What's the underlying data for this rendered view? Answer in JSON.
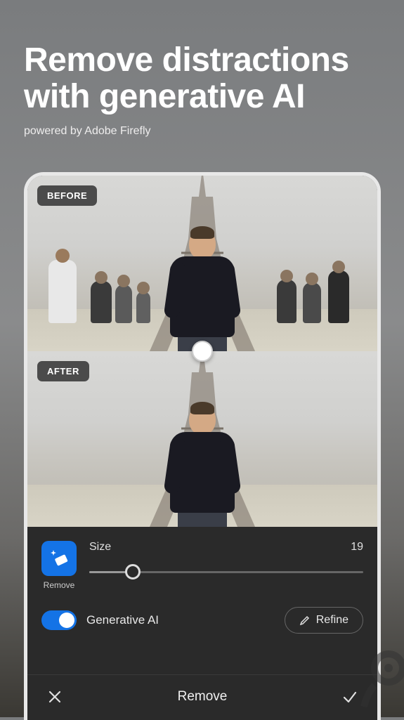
{
  "hero": {
    "title": "Remove distractions with generative AI",
    "subtitle": "powered by Adobe Firefly"
  },
  "comparison": {
    "before_label": "BEFORE",
    "after_label": "AFTER"
  },
  "editor": {
    "tool_label": "Remove",
    "size_label": "Size",
    "size_value": "19",
    "gen_ai_label": "Generative AI",
    "gen_ai_on": true,
    "refine_label": "Refine",
    "bottom_title": "Remove"
  }
}
